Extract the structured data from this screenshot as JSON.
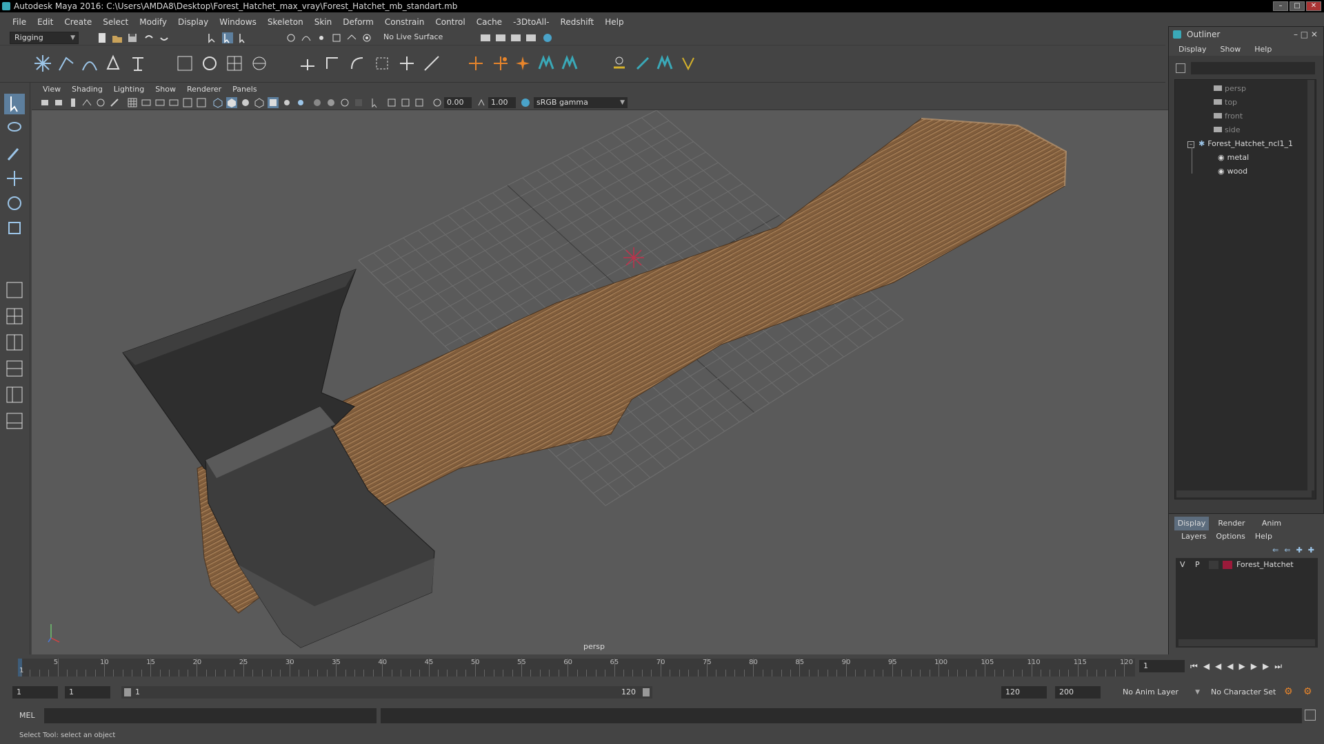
{
  "window": {
    "title": "Autodesk Maya 2016: C:\\Users\\AMDA8\\Desktop\\Forest_Hatchet_max_vray\\Forest_Hatchet_mb_standart.mb"
  },
  "menubar": [
    "File",
    "Edit",
    "Create",
    "Select",
    "Modify",
    "Display",
    "Windows",
    "Skeleton",
    "Skin",
    "Deform",
    "Constrain",
    "Control",
    "Cache",
    "-3DtoAll-",
    "Redshift",
    "Help"
  ],
  "statusline": {
    "menuset": "Rigging",
    "live_surface": "No Live Surface"
  },
  "panel": {
    "menus": [
      "View",
      "Shading",
      "Lighting",
      "Show",
      "Renderer",
      "Panels"
    ],
    "exposure": "0.00",
    "gamma": "1.00",
    "colorspace": "sRGB gamma",
    "camera_label": "persp"
  },
  "outliner": {
    "title": "Outliner",
    "menus": [
      "Display",
      "Show",
      "Help"
    ],
    "items": [
      {
        "label": "persp"
      },
      {
        "label": "top"
      },
      {
        "label": "front"
      },
      {
        "label": "side"
      },
      {
        "label": "Forest_Hatchet_ncl1_1"
      },
      {
        "label": "metal"
      },
      {
        "label": "wood"
      }
    ]
  },
  "layers": {
    "tabs": [
      "Display",
      "Render",
      "Anim"
    ],
    "menus": [
      "Layers",
      "Options",
      "Help"
    ],
    "layer": {
      "v": "V",
      "p": "P",
      "name": "Forest_Hatchet",
      "color": "#9b1a3a"
    }
  },
  "timeslider": {
    "labels": [
      "5",
      "10",
      "15",
      "20",
      "25",
      "30",
      "35",
      "40",
      "45",
      "50",
      "55",
      "60",
      "65",
      "70",
      "75",
      "80",
      "85",
      "90",
      "95",
      "100",
      "105",
      "110",
      "115",
      "120"
    ],
    "start": "1",
    "current_frame": "1"
  },
  "rangeslider": {
    "start": "1",
    "start2": "1",
    "range_start": "1",
    "range_end": "120",
    "end": "120",
    "end2": "200",
    "anim_layer": "No Anim Layer",
    "char_set": "No Character Set"
  },
  "cmdline": {
    "label": "MEL"
  },
  "helpline": {
    "text": "Select Tool: select an object"
  }
}
